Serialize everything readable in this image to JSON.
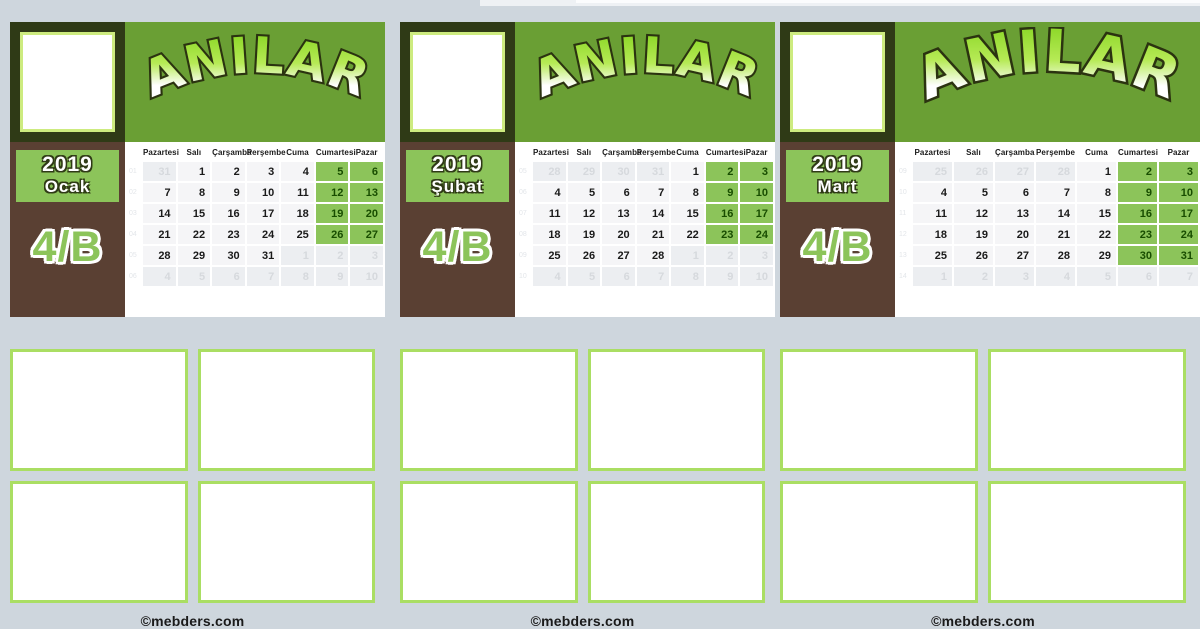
{
  "theme": {
    "green": "#6a9f34",
    "light_green": "#8cc45a",
    "frame_green": "#aade63",
    "brown": "#5a4033",
    "dark_olive": "#2f3a16",
    "page_bg": "#ced6dd"
  },
  "weekdays": [
    "Pazartesi",
    "Salı",
    "Çarşamba",
    "Perşembe",
    "Cuma",
    "Cumartesi",
    "Pazar"
  ],
  "footer": "©mebders.com",
  "banner_title": "ANILAR",
  "class_label": "4/B",
  "year": "2019",
  "panels": [
    {
      "id": "ocak",
      "month": "Ocak",
      "year": "2019",
      "week_numbers": [
        "01",
        "02",
        "03",
        "04",
        "05",
        "06"
      ],
      "weeks": [
        [
          {
            "d": "31",
            "out": true
          },
          {
            "d": "1"
          },
          {
            "d": "2"
          },
          {
            "d": "3"
          },
          {
            "d": "4"
          },
          {
            "d": "5",
            "wknd": true
          },
          {
            "d": "6",
            "wknd": true
          }
        ],
        [
          {
            "d": "7"
          },
          {
            "d": "8"
          },
          {
            "d": "9"
          },
          {
            "d": "10"
          },
          {
            "d": "11"
          },
          {
            "d": "12",
            "wknd": true
          },
          {
            "d": "13",
            "wknd": true
          }
        ],
        [
          {
            "d": "14"
          },
          {
            "d": "15"
          },
          {
            "d": "16"
          },
          {
            "d": "17"
          },
          {
            "d": "18"
          },
          {
            "d": "19",
            "wknd": true
          },
          {
            "d": "20",
            "wknd": true
          }
        ],
        [
          {
            "d": "21"
          },
          {
            "d": "22"
          },
          {
            "d": "23"
          },
          {
            "d": "24"
          },
          {
            "d": "25"
          },
          {
            "d": "26",
            "wknd": true
          },
          {
            "d": "27",
            "wknd": true
          }
        ],
        [
          {
            "d": "28"
          },
          {
            "d": "29"
          },
          {
            "d": "30"
          },
          {
            "d": "31"
          },
          {
            "d": "1",
            "out": true
          },
          {
            "d": "2",
            "wknd": true,
            "out": true
          },
          {
            "d": "3",
            "wknd": true,
            "out": true
          }
        ],
        [
          {
            "d": "4",
            "out": true
          },
          {
            "d": "5",
            "out": true
          },
          {
            "d": "6",
            "out": true
          },
          {
            "d": "7",
            "out": true
          },
          {
            "d": "8",
            "out": true
          },
          {
            "d": "9",
            "wknd": true,
            "out": true
          },
          {
            "d": "10",
            "wknd": true,
            "out": true
          }
        ]
      ]
    },
    {
      "id": "subat",
      "month": "Şubat",
      "year": "2019",
      "week_numbers": [
        "05",
        "06",
        "07",
        "08",
        "09",
        "10"
      ],
      "weeks": [
        [
          {
            "d": "28",
            "out": true
          },
          {
            "d": "29",
            "out": true
          },
          {
            "d": "30",
            "out": true
          },
          {
            "d": "31",
            "out": true
          },
          {
            "d": "1"
          },
          {
            "d": "2",
            "wknd": true
          },
          {
            "d": "3",
            "wknd": true
          }
        ],
        [
          {
            "d": "4"
          },
          {
            "d": "5"
          },
          {
            "d": "6"
          },
          {
            "d": "7"
          },
          {
            "d": "8"
          },
          {
            "d": "9",
            "wknd": true
          },
          {
            "d": "10",
            "wknd": true
          }
        ],
        [
          {
            "d": "11"
          },
          {
            "d": "12"
          },
          {
            "d": "13"
          },
          {
            "d": "14"
          },
          {
            "d": "15"
          },
          {
            "d": "16",
            "wknd": true
          },
          {
            "d": "17",
            "wknd": true
          }
        ],
        [
          {
            "d": "18"
          },
          {
            "d": "19"
          },
          {
            "d": "20"
          },
          {
            "d": "21"
          },
          {
            "d": "22"
          },
          {
            "d": "23",
            "wknd": true
          },
          {
            "d": "24",
            "wknd": true
          }
        ],
        [
          {
            "d": "25"
          },
          {
            "d": "26"
          },
          {
            "d": "27"
          },
          {
            "d": "28"
          },
          {
            "d": "1",
            "out": true
          },
          {
            "d": "2",
            "wknd": true,
            "out": true
          },
          {
            "d": "3",
            "wknd": true,
            "out": true
          }
        ],
        [
          {
            "d": "4",
            "out": true
          },
          {
            "d": "5",
            "out": true
          },
          {
            "d": "6",
            "out": true
          },
          {
            "d": "7",
            "out": true
          },
          {
            "d": "8",
            "out": true
          },
          {
            "d": "9",
            "wknd": true,
            "out": true
          },
          {
            "d": "10",
            "wknd": true,
            "out": true
          }
        ]
      ]
    },
    {
      "id": "mart",
      "month": "Mart",
      "year": "2019",
      "week_numbers": [
        "09",
        "10",
        "11",
        "12",
        "13",
        "14"
      ],
      "weeks": [
        [
          {
            "d": "25",
            "out": true
          },
          {
            "d": "26",
            "out": true
          },
          {
            "d": "27",
            "out": true
          },
          {
            "d": "28",
            "out": true
          },
          {
            "d": "1"
          },
          {
            "d": "2",
            "wknd": true
          },
          {
            "d": "3",
            "wknd": true
          }
        ],
        [
          {
            "d": "4"
          },
          {
            "d": "5"
          },
          {
            "d": "6"
          },
          {
            "d": "7"
          },
          {
            "d": "8"
          },
          {
            "d": "9",
            "wknd": true
          },
          {
            "d": "10",
            "wknd": true
          }
        ],
        [
          {
            "d": "11"
          },
          {
            "d": "12"
          },
          {
            "d": "13"
          },
          {
            "d": "14"
          },
          {
            "d": "15"
          },
          {
            "d": "16",
            "wknd": true
          },
          {
            "d": "17",
            "wknd": true
          }
        ],
        [
          {
            "d": "18"
          },
          {
            "d": "19"
          },
          {
            "d": "20"
          },
          {
            "d": "21"
          },
          {
            "d": "22"
          },
          {
            "d": "23",
            "wknd": true
          },
          {
            "d": "24",
            "wknd": true
          }
        ],
        [
          {
            "d": "25"
          },
          {
            "d": "26"
          },
          {
            "d": "27"
          },
          {
            "d": "28"
          },
          {
            "d": "29"
          },
          {
            "d": "30",
            "wknd": true
          },
          {
            "d": "31",
            "wknd": true
          }
        ],
        [
          {
            "d": "1",
            "out": true
          },
          {
            "d": "2",
            "out": true
          },
          {
            "d": "3",
            "out": true
          },
          {
            "d": "4",
            "out": true
          },
          {
            "d": "5",
            "out": true
          },
          {
            "d": "6",
            "wknd": true,
            "out": true
          },
          {
            "d": "7",
            "wknd": true,
            "out": true
          }
        ]
      ]
    }
  ]
}
